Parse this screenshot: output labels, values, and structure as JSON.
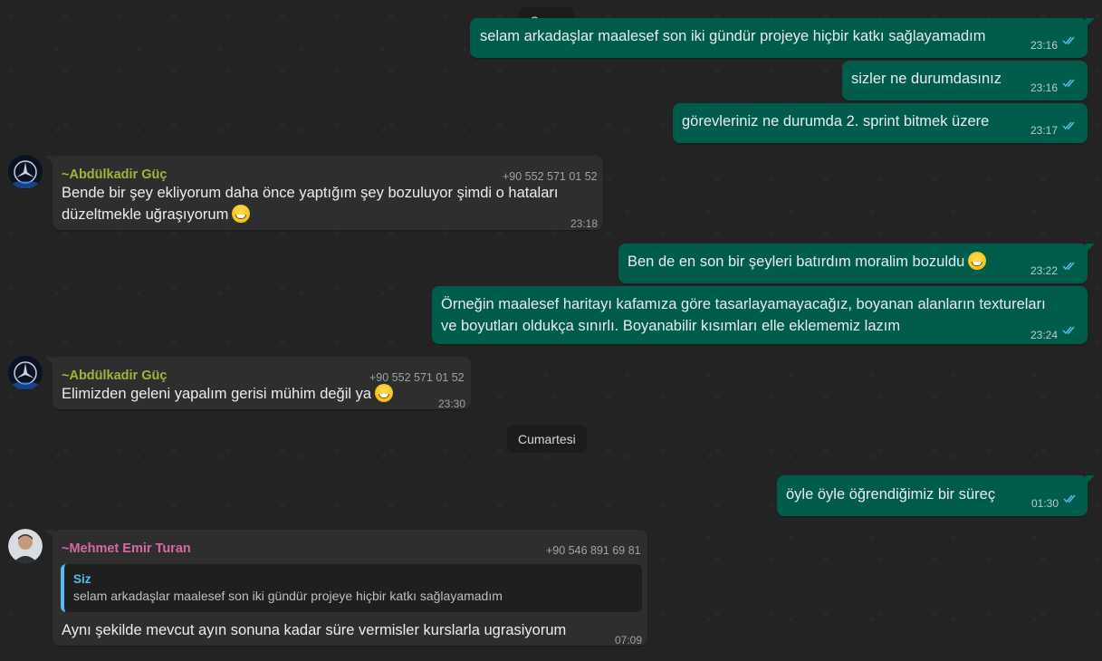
{
  "dates": {
    "friday": "Cuma",
    "saturday": "Cumartesi"
  },
  "outgoing": [
    {
      "text": "selam arkadaşlar maalesef son iki gündür projeye hiçbir katkı sağlayamadım",
      "time": "23:16"
    },
    {
      "text": "sizler ne durumdasınız",
      "time": "23:16"
    },
    {
      "text": "görevleriniz ne durumda 2. sprint bitmek üzere",
      "time": "23:17"
    },
    {
      "text": "Ben de en son bir şeyleri batırdım moralim bozuldu",
      "time": "23:22"
    },
    {
      "line1": "Örneğin maalesef haritayı kafamıza göre tasarlayamayacağız, boyanan alanların textureları",
      "line2": "ve boyutları oldukça sınırlı. Boyanabilir kısımları elle eklememiz lazım",
      "time": "23:24"
    },
    {
      "text": "öyle öyle öğrendiğimiz bir süreç",
      "time": "01:30"
    }
  ],
  "incoming": [
    {
      "sender": "~Abdülkadir Güç",
      "phone": "+90 552 571 01 52",
      "line1": "Bende bir şey ekliyorum daha önce yaptığım şey bozuluyor şimdi o hataları",
      "line2": "düzeltmekle uğraşıyorum",
      "time": "23:18"
    },
    {
      "sender": "~Abdülkadir Güç",
      "phone": "+90 552 571 01 52",
      "text": "Elimizden geleni yapalım gerisi mühim değil ya",
      "time": "23:30"
    },
    {
      "sender": "~Mehmet Emir Turan",
      "phone": "+90 546 891 69 81",
      "quote_author": "Siz",
      "quote_text": "selam arkadaşlar maalesef son iki gündür projeye hiçbir katkı sağlayamadım",
      "text": "Aynı şekilde mevcut ayın sonuna kadar süre vermisler kurslarla ugrasiyorum",
      "time": "07:09"
    }
  ],
  "colors": {
    "outgoing_bubble": "#005c4b",
    "incoming_bubble": "#2e2e2e",
    "sender_abdulkadir": "#a5b337",
    "sender_mehmet": "#d867a6",
    "read_ticks": "#53bdeb"
  }
}
